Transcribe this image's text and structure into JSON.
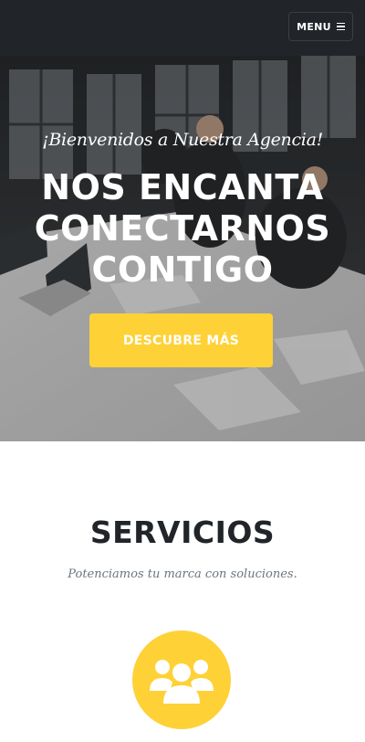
{
  "navbar": {
    "menu_label": "MENU",
    "menu_icon": "hamburger-icon"
  },
  "hero": {
    "subheading": "¡Bienvenidos a Nuestra Agencia!",
    "heading_lines": [
      "NOS ENCANTA",
      "CONECTARNOS",
      "CONTIGO"
    ],
    "cta_label": "DESCUBRE MÁS"
  },
  "services": {
    "heading": "SERVICIOS",
    "subheading": "Potenciamos tu marca con soluciones.",
    "icon": "users-icon"
  },
  "colors": {
    "navbar_bg": "#212529",
    "accent": "#fed136",
    "heading_text": "#212529",
    "muted_text": "#6c757d"
  }
}
